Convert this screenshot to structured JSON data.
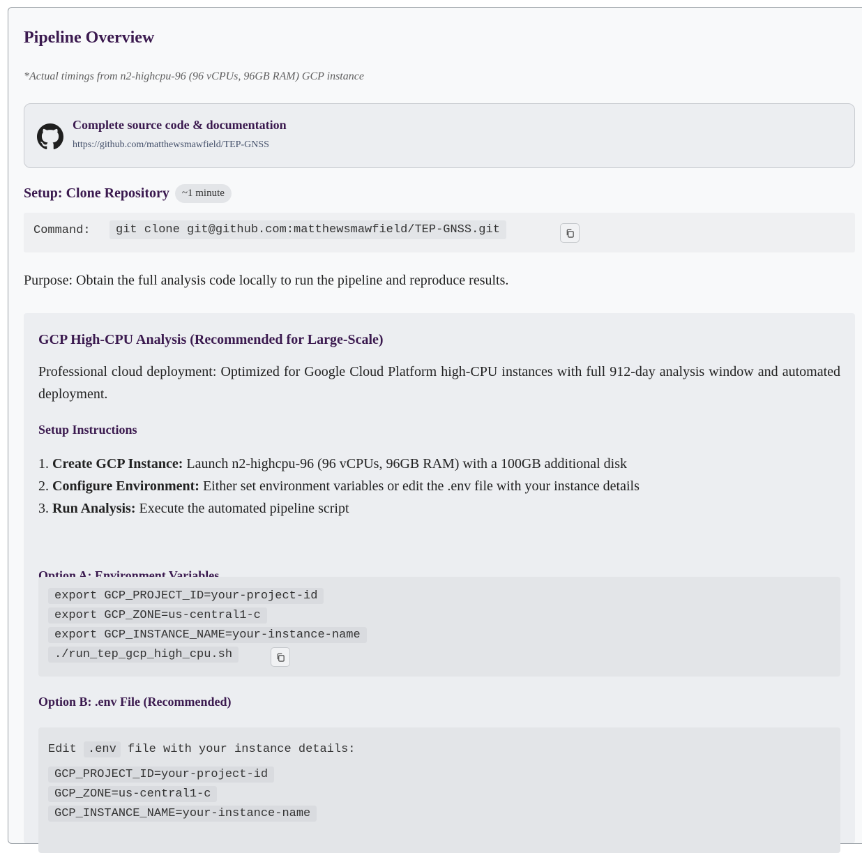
{
  "title": "Pipeline Overview",
  "timing_note": "*Actual timings from n2-highcpu-96 (96 vCPUs, 96GB RAM) GCP instance",
  "repo": {
    "title": "Complete source code & documentation",
    "url": "https://github.com/matthewsmawfield/TEP-GNSS",
    "icon": "github-icon"
  },
  "setup": {
    "title": "Setup: Clone Repository",
    "duration": "~1 minute",
    "command_label": "Command:",
    "command": "git clone git@github.com:matthewsmawfield/TEP-GNSS.git",
    "copy_icon": "copy-icon"
  },
  "purpose": "Purpose: Obtain the full analysis code locally to run the pipeline and reproduce results.",
  "gcp": {
    "title": "GCP High-CPU Analysis (Recommended for Large-Scale)",
    "description": "Professional cloud deployment: Optimized for Google Cloud Platform high-CPU instances with full 912-day analysis window and automated deployment.",
    "instructions_heading": "Setup Instructions",
    "steps": [
      {
        "num": "1.",
        "bold": "Create GCP Instance:",
        "text": " Launch n2-highcpu-96 (96 vCPUs, 96GB RAM) with a 100GB additional disk"
      },
      {
        "num": "2.",
        "bold": "Configure Environment:",
        "text": " Either set environment variables or edit the .env file with your instance details"
      },
      {
        "num": "3.",
        "bold": "Run Analysis:",
        "text": " Execute the automated pipeline script"
      }
    ],
    "option_a": {
      "heading": "Option A: Environment Variables",
      "lines": [
        "export GCP_PROJECT_ID=your-project-id",
        "export GCP_ZONE=us-central1-c",
        "export GCP_INSTANCE_NAME=your-instance-name",
        "./run_tep_gcp_high_cpu.sh"
      ]
    },
    "option_b": {
      "heading": "Option B: .env File (Recommended)",
      "intro_before": "Edit",
      "intro_code": ".env",
      "intro_after": "file with your instance details:",
      "lines": [
        "GCP_PROJECT_ID=your-project-id",
        "GCP_ZONE=us-central1-c",
        "GCP_INSTANCE_NAME=your-instance-name"
      ]
    }
  }
}
